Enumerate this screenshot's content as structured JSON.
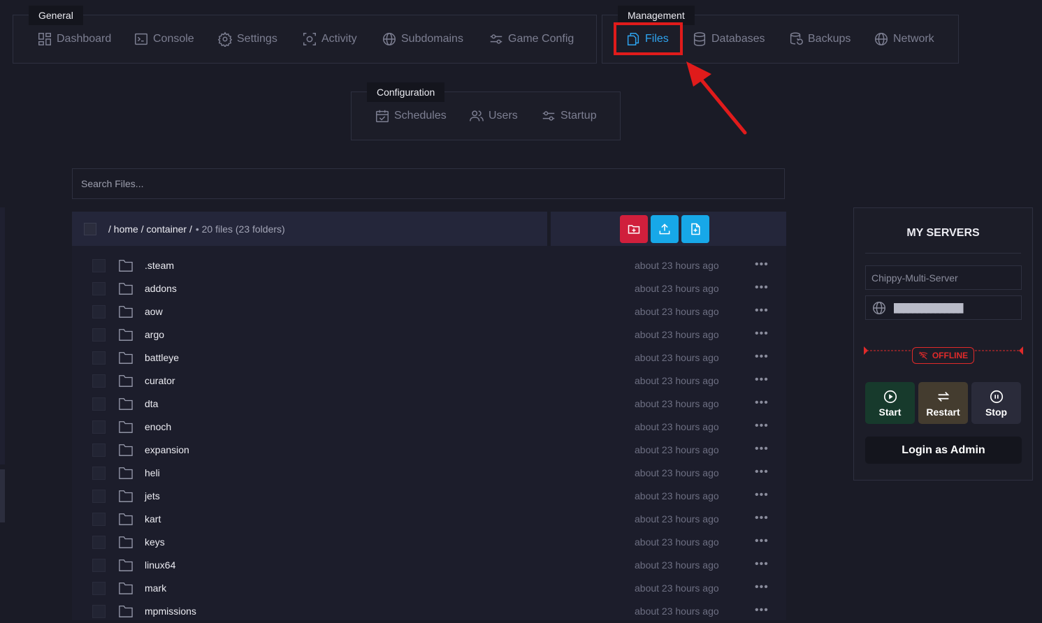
{
  "nav": {
    "general": {
      "title": "General",
      "items": [
        {
          "label": "Dashboard",
          "icon": "dashboard-icon"
        },
        {
          "label": "Console",
          "icon": "console-icon"
        },
        {
          "label": "Settings",
          "icon": "gear-icon"
        },
        {
          "label": "Activity",
          "icon": "activity-icon"
        },
        {
          "label": "Subdomains",
          "icon": "globe-icon"
        },
        {
          "label": "Game Config",
          "icon": "sliders-icon"
        }
      ]
    },
    "management": {
      "title": "Management",
      "items": [
        {
          "label": "Files",
          "icon": "files-icon",
          "active": true
        },
        {
          "label": "Databases",
          "icon": "database-icon"
        },
        {
          "label": "Backups",
          "icon": "backup-icon"
        },
        {
          "label": "Network",
          "icon": "globe-icon"
        }
      ]
    },
    "configuration": {
      "title": "Configuration",
      "items": [
        {
          "label": "Schedules",
          "icon": "calendar-icon"
        },
        {
          "label": "Users",
          "icon": "users-icon"
        },
        {
          "label": "Startup",
          "icon": "sliders-icon"
        }
      ]
    }
  },
  "search": {
    "placeholder": "Search Files..."
  },
  "breadcrumb": {
    "path": "/ home / container /",
    "summary": "• 20 files (23 folders)"
  },
  "actions": {
    "new_folder_color": "#d01f3c",
    "upload_color": "#17a8e8",
    "new_file_color": "#17a8e8"
  },
  "files": [
    {
      "name": ".steam",
      "modified": "about 23 hours ago"
    },
    {
      "name": "addons",
      "modified": "about 23 hours ago"
    },
    {
      "name": "aow",
      "modified": "about 23 hours ago"
    },
    {
      "name": "argo",
      "modified": "about 23 hours ago"
    },
    {
      "name": "battleye",
      "modified": "about 23 hours ago"
    },
    {
      "name": "curator",
      "modified": "about 23 hours ago"
    },
    {
      "name": "dta",
      "modified": "about 23 hours ago"
    },
    {
      "name": "enoch",
      "modified": "about 23 hours ago"
    },
    {
      "name": "expansion",
      "modified": "about 23 hours ago"
    },
    {
      "name": "heli",
      "modified": "about 23 hours ago"
    },
    {
      "name": "jets",
      "modified": "about 23 hours ago"
    },
    {
      "name": "kart",
      "modified": "about 23 hours ago"
    },
    {
      "name": "keys",
      "modified": "about 23 hours ago"
    },
    {
      "name": "linux64",
      "modified": "about 23 hours ago"
    },
    {
      "name": "mark",
      "modified": "about 23 hours ago"
    },
    {
      "name": "mpmissions",
      "modified": "about 23 hours ago"
    }
  ],
  "servers": {
    "title": "MY SERVERS",
    "server_name": "Chippy-Multi-Server",
    "address_redacted": "███████████████",
    "status": "OFFLINE",
    "status_color": "#e02a2a",
    "start_label": "Start",
    "restart_label": "Restart",
    "stop_label": "Stop",
    "login_label": "Login as Admin"
  },
  "colors": {
    "accent": "#2ea4f0",
    "annotation_red": "#e01b1b"
  }
}
